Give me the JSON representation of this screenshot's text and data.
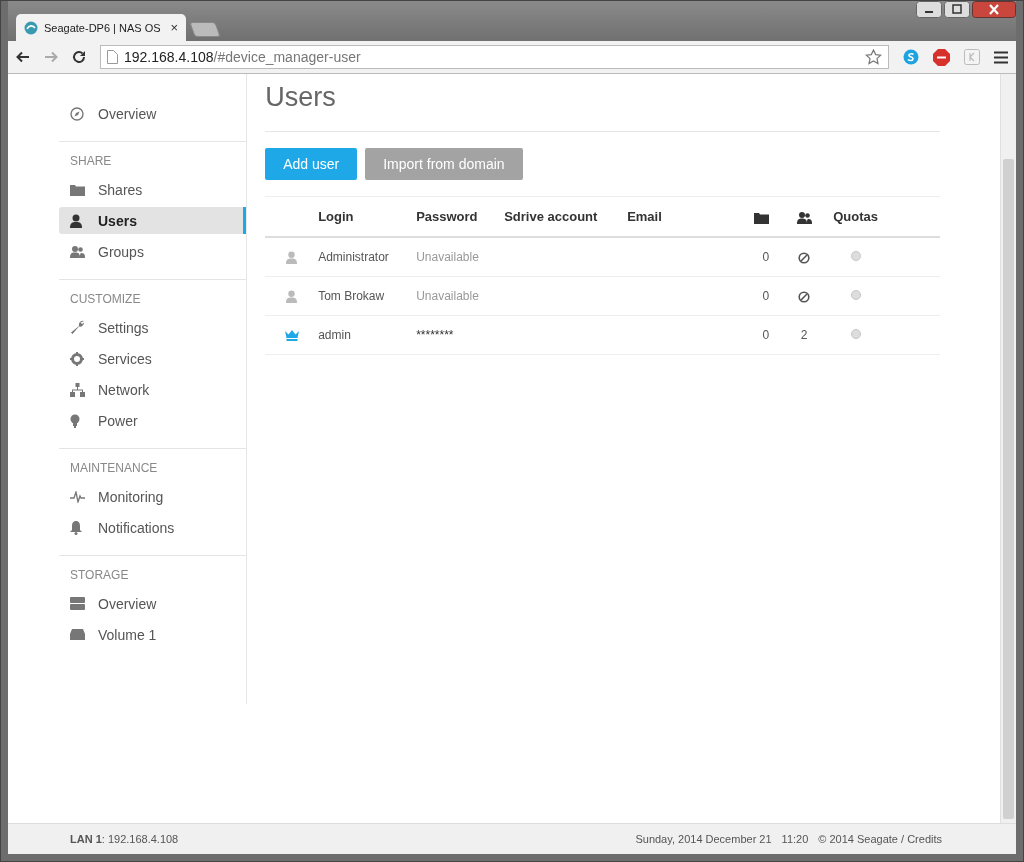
{
  "browser": {
    "tab_title": "Seagate-DP6 | NAS OS",
    "tab_close": "×",
    "url_host": "192.168.4.108",
    "url_path": "/#device_manager-user"
  },
  "sidebar": {
    "sections": [
      {
        "items": [
          {
            "label": "Overview",
            "selected": false
          }
        ]
      },
      {
        "heading": "SHARE",
        "items": [
          {
            "label": "Shares",
            "selected": false
          },
          {
            "label": "Users",
            "selected": true
          },
          {
            "label": "Groups",
            "selected": false
          }
        ]
      },
      {
        "heading": "CUSTOMIZE",
        "items": [
          {
            "label": "Settings",
            "selected": false
          },
          {
            "label": "Services",
            "selected": false
          },
          {
            "label": "Network",
            "selected": false
          },
          {
            "label": "Power",
            "selected": false
          }
        ]
      },
      {
        "heading": "MAINTENANCE",
        "items": [
          {
            "label": "Monitoring",
            "selected": false
          },
          {
            "label": "Notifications",
            "selected": false
          }
        ]
      },
      {
        "heading": "STORAGE",
        "items": [
          {
            "label": "Overview",
            "selected": false
          },
          {
            "label": "Volume 1",
            "selected": false
          }
        ]
      }
    ]
  },
  "page": {
    "title": "Users",
    "buttons": [
      {
        "label": "Add user",
        "kind": "primary"
      },
      {
        "label": "Import from domain",
        "kind": "secondary"
      }
    ]
  },
  "table": {
    "columns": [
      {
        "kind": "blank"
      },
      {
        "kind": "text",
        "label": "Login"
      },
      {
        "kind": "text",
        "label": "Password"
      },
      {
        "kind": "text",
        "label": "Sdrive account"
      },
      {
        "kind": "text",
        "label": "Email"
      },
      {
        "kind": "folder"
      },
      {
        "kind": "users"
      },
      {
        "kind": "text",
        "label": "Quotas"
      }
    ],
    "rows": [
      {
        "kind": "user",
        "login": "Administrator",
        "password": "Unavailable",
        "password_available": false,
        "shares": "0",
        "groups": {
          "kind": "none"
        }
      },
      {
        "kind": "user",
        "login": "Tom Brokaw",
        "password": "Unavailable",
        "password_available": false,
        "shares": "0",
        "groups": {
          "kind": "none"
        }
      },
      {
        "kind": "admin",
        "login": "admin",
        "password": "********",
        "password_available": true,
        "shares": "0",
        "groups": {
          "kind": "count",
          "text": "2"
        }
      }
    ]
  },
  "status_bar": {
    "lan": "**LAN 1**: 192.168.4.108",
    "date": "Sunday, 2014 December 21",
    "time": "11:20",
    "copyright": "© 2014 Seagate / Credits"
  }
}
